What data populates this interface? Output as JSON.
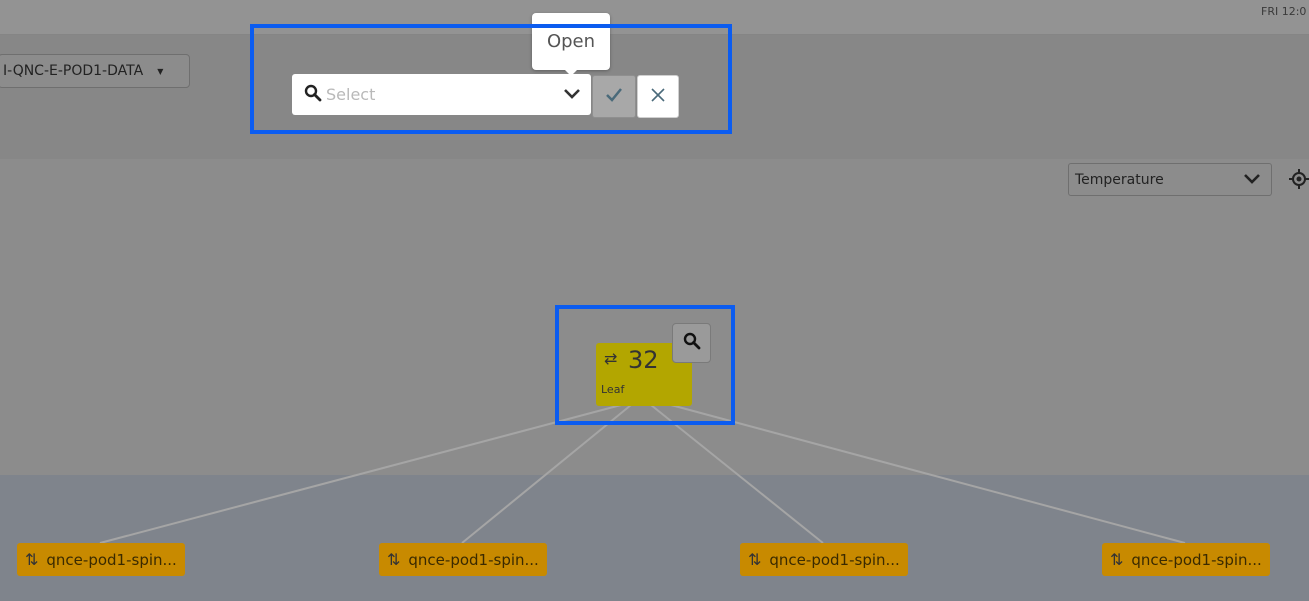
{
  "topbar": {
    "clock": "FRI 12:0"
  },
  "fabric_selector": {
    "value": "I-QNC-E-POD1-DATA"
  },
  "tooltip": {
    "text": "Open"
  },
  "search": {
    "placeholder": "Select",
    "value": ""
  },
  "metric_selector": {
    "value": "Temperature"
  },
  "leaf_node": {
    "count": "32",
    "label": "Leaf"
  },
  "spines": [
    {
      "label": "qnce-pod1-spin..."
    },
    {
      "label": "qnce-pod1-spin..."
    },
    {
      "label": "qnce-pod1-spin..."
    },
    {
      "label": "qnce-pod1-spin..."
    }
  ],
  "colors": {
    "highlight": "#0b5cf0",
    "leaf": "#b3a600",
    "spine": "#c88a00",
    "link": "#a5a5a5"
  },
  "icons": [
    "search-icon",
    "chevron-down-icon",
    "check-icon",
    "close-icon",
    "locate-icon",
    "zoom-icon",
    "swap-arrows-icon",
    "updown-arrows-icon"
  ]
}
